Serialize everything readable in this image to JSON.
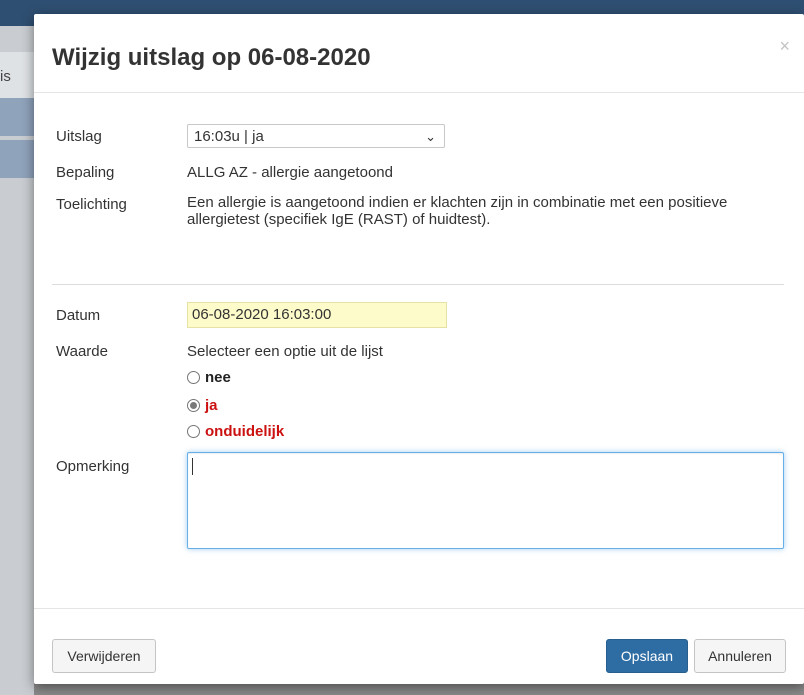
{
  "background": {
    "tab_text": "is"
  },
  "modal": {
    "title": "Wijzig uitslag op 06-08-2020",
    "close_glyph": "×",
    "close_icon": "close-icon"
  },
  "fields": {
    "uitslag": {
      "label": "Uitslag",
      "selected": "16:03u | ja"
    },
    "bepaling": {
      "label": "Bepaling",
      "value": "ALLG AZ - allergie aangetoond"
    },
    "toelichting": {
      "label": "Toelichting",
      "value": "Een allergie is aangetoond indien er klachten zijn in combinatie met een positieve allergietest (specifiek IgE (RAST) of huidtest)."
    },
    "datum": {
      "label": "Datum",
      "value": "06-08-2020 16:03:00"
    },
    "waarde": {
      "label": "Waarde",
      "instruction": "Selecteer een optie uit de lijst",
      "options": [
        {
          "label": "nee",
          "checked": false,
          "color": "#222222"
        },
        {
          "label": "ja",
          "checked": true,
          "color": "#cc1111"
        },
        {
          "label": "onduidelijk",
          "checked": false,
          "color": "#cc1111"
        }
      ]
    },
    "opmerking": {
      "label": "Opmerking",
      "value": ""
    }
  },
  "footer": {
    "delete_label": "Verwijderen",
    "save_label": "Opslaan",
    "cancel_label": "Annuleren"
  },
  "colors": {
    "primary": "#2e6da4",
    "date_highlight": "#fdfbc9",
    "option_red": "#cc1111"
  }
}
